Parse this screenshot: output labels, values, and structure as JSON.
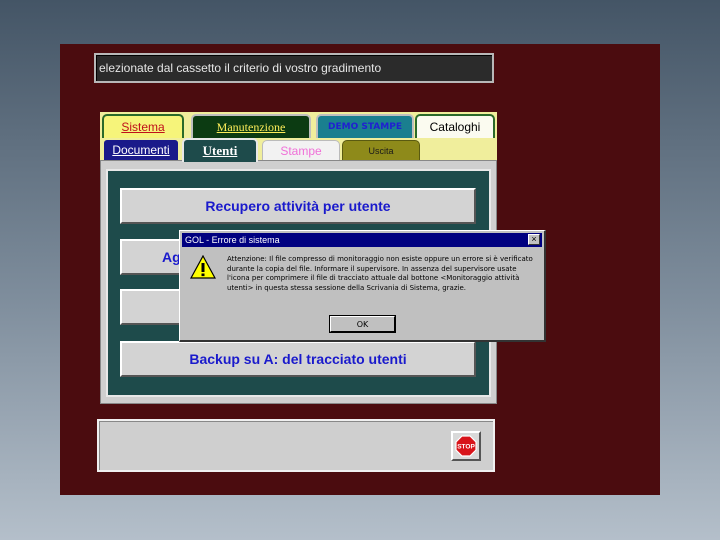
{
  "hint_text": "elezionate dal cassetto il criterio di vostro gradimento",
  "tabs_top": [
    {
      "label": "Sistema"
    },
    {
      "label": "Manutenzione"
    },
    {
      "label": "DEMO STAMPE"
    },
    {
      "label": "Cataloghi"
    }
  ],
  "tabs_bottom": [
    {
      "label": "Documenti"
    },
    {
      "label": "Utenti"
    },
    {
      "label": "Stampe"
    },
    {
      "label": "Uscita"
    }
  ],
  "buttons": [
    {
      "label": "Recupero attività per utente"
    },
    {
      "label": "Ag"
    },
    {
      "label": ""
    },
    {
      "label": "Backup su A:  del tracciato utenti"
    }
  ],
  "stop_label": "STOP",
  "dialog": {
    "title": "GOL - Errore di sistema",
    "close": "×",
    "message": "Attenzione: Il file compresso di monitoraggio non esiste oppure un errore si è verificato durante la copia del file. Informare il supervisore. In assenza del supervisore usate l'icona per comprimere il file di tracciato attuale dal bottone <Monitoraggio attività utenti> in questa stessa sessione della Scrivania di Sistema, grazie.",
    "ok_label": "OK",
    "icon": "warning-icon"
  },
  "colors": {
    "app_bg": "#4b0c0f",
    "panel_teal": "#1e4b4b",
    "button_text": "#1a1acc",
    "dialog_title": "#000080"
  }
}
